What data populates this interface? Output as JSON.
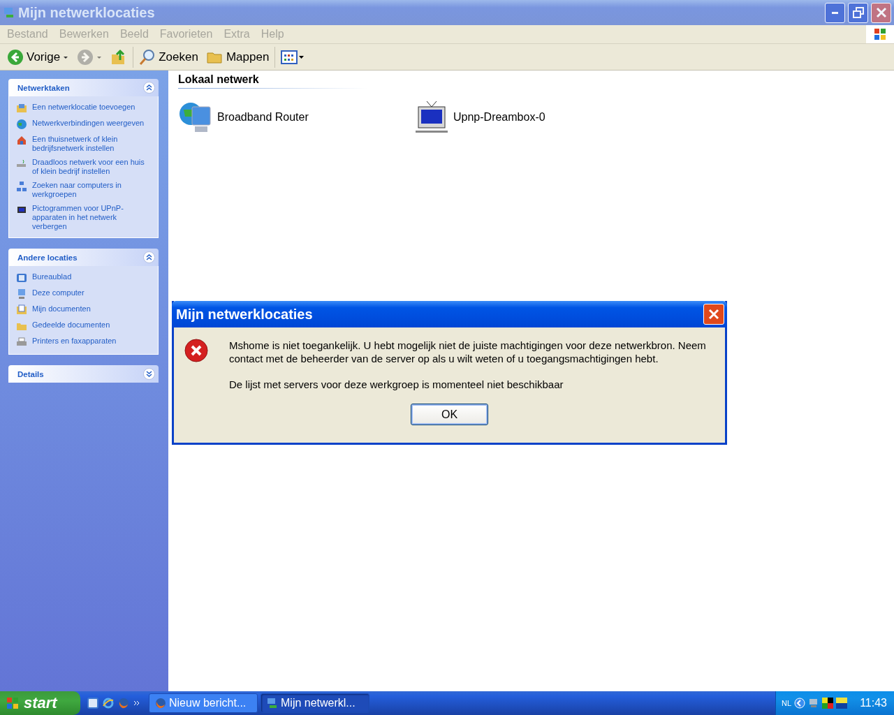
{
  "window": {
    "title": "Mijn netwerklocaties",
    "active": false
  },
  "menu": [
    "Bestand",
    "Bewerken",
    "Beeld",
    "Favorieten",
    "Extra",
    "Help"
  ],
  "toolbar": [
    {
      "kind": "back",
      "label": "Vorige",
      "disabled": false
    },
    {
      "kind": "forward",
      "disabled": true
    },
    {
      "kind": "up",
      "disabled": false
    },
    {
      "kind": "search",
      "label": "Zoeken",
      "disabled": false
    },
    {
      "kind": "folders",
      "label": "Mappen",
      "disabled": false
    },
    {
      "kind": "views",
      "disabled": false
    }
  ],
  "sidebar": [
    {
      "title": "Netwerktaken",
      "expanded": true,
      "items": [
        "Een netwerklocatie toevoegen",
        "Netwerkverbindingen weergeven",
        "Een thuisnetwerk of klein bedrijfsnetwerk instellen",
        "Draadloos netwerk voor een huis of klein bedrijf instellen",
        "Zoeken naar computers in werkgroepen",
        "Pictogrammen voor UPnP-apparaten in het netwerk verbergen"
      ]
    },
    {
      "title": "Andere locaties",
      "expanded": true,
      "items": [
        "Bureaublad",
        "Deze computer",
        "Mijn documenten",
        "Gedeelde documenten",
        "Printers en faxapparaten"
      ]
    },
    {
      "title": "Details",
      "expanded": false
    }
  ],
  "group": {
    "title": "Lokaal netwerk",
    "items": [
      "Broadband Router",
      "Upnp-Dreambox-0"
    ]
  },
  "dialog": {
    "title": "Mijn netwerklocaties",
    "lines": [
      "Mshome is niet toegankelijk. U hebt mogelijk niet de juiste machtigingen voor deze netwerkbron. Neem contact met de beheerder van de server op als u wilt weten of u toegangsmachtigingen hebt.",
      "De lijst met servers voor deze werkgroep is momenteel niet beschikbaar"
    ],
    "button": "OK"
  },
  "taskbar": {
    "start": "start",
    "tasks": [
      {
        "label": "Nieuw bericht...",
        "selected": false
      },
      {
        "label": "Mijn netwerkl...",
        "selected": true
      }
    ],
    "language": "NL",
    "clock": "11:43"
  }
}
